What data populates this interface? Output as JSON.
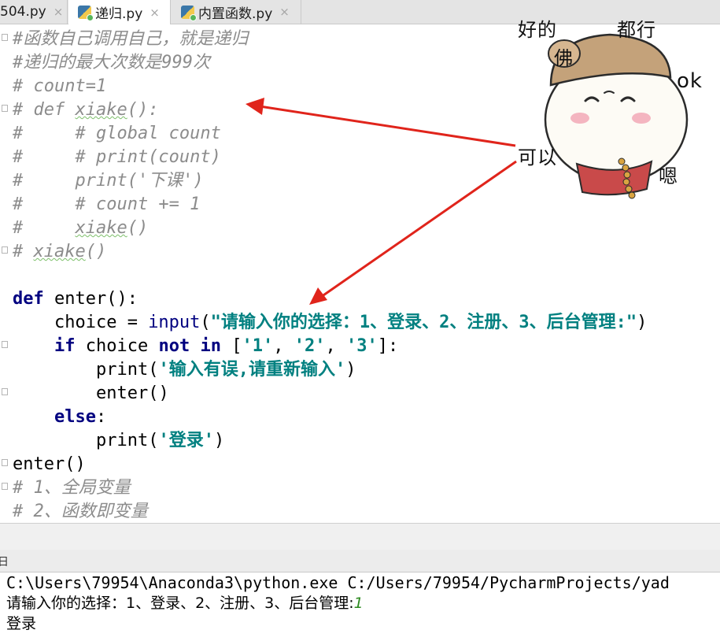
{
  "tabs": [
    {
      "label": "504.py",
      "close": "×",
      "active": false
    },
    {
      "label": "递归.py",
      "close": "×",
      "active": true
    },
    {
      "label": "内置函数.py",
      "close": "×",
      "active": false
    }
  ],
  "code_lines": [
    "#函数自己调用自己，就是递归",
    "#递归的最大次数是999次",
    "# count=1",
    "# def xiake():",
    "#     # global count",
    "#     # print(count)",
    "#     print('下课')",
    "#     # count += 1",
    "#     xiake()",
    "# xiake()",
    "",
    "def enter():",
    "    choice = input(\"请输入你的选择：1、登录、2、注册、3、后台管理:\")",
    "    if choice not in ['1', '2', '3']:",
    "        print('输入有误,请重新输入')",
    "        enter()",
    "    else:",
    "        print('登录')",
    "enter()",
    "# 1、全局变量",
    "# 2、函数即变量"
  ],
  "code": {
    "kw_def": "def",
    "fn_enter": " enter():",
    "choice_assign": "    choice = ",
    "bi_input": "input",
    "paren_open": "(",
    "prompt_str": "\"请输入你的选择：1、登录、2、注册、3、后台管理:\"",
    "paren_close": ")",
    "indent4": "    ",
    "indent8": "        ",
    "kw_if": "if",
    "choice_mid": " choice ",
    "kw_not": "not",
    "sp": " ",
    "kw_in": "in",
    "list_open": " [",
    "str_1": "'1'",
    "comma": ", ",
    "str_2": "'2'",
    "str_3": "'3'",
    "list_close": "]:",
    "print_open": "print(",
    "str_err": "'输入有误,请重新输入'",
    "close_paren": ")",
    "enter_call": "enter()",
    "kw_else": "else",
    "colon": ":",
    "str_login": "'登录'",
    "cm_prefix_def": "# def ",
    "cm_xiake_word": "xiake",
    "cm_def_tail": "():",
    "cm_indent": "#     ",
    "cm_call_tail": "()",
    "cm_prefix": "# "
  },
  "run_panel": {
    "tab_label": "日",
    "command": "C:\\Users\\79954\\Anaconda3\\python.exe C:/Users/79954/PycharmProjects/yad",
    "prompt_output": "请输入你的选择：1、登录、2、注册、3、后台管理:",
    "user_input": "1",
    "result_output": "登录"
  },
  "sticker": {
    "top_left_text": "好的",
    "top_right_text": "都行",
    "ok_text": "ok",
    "hat_text": "佛",
    "side_text": "嗯",
    "arrow_label": "可以"
  },
  "colors": {
    "keyword": "#000080",
    "string": "#008080",
    "comment": "#8c8c8c",
    "arrow": "#e0241b"
  }
}
